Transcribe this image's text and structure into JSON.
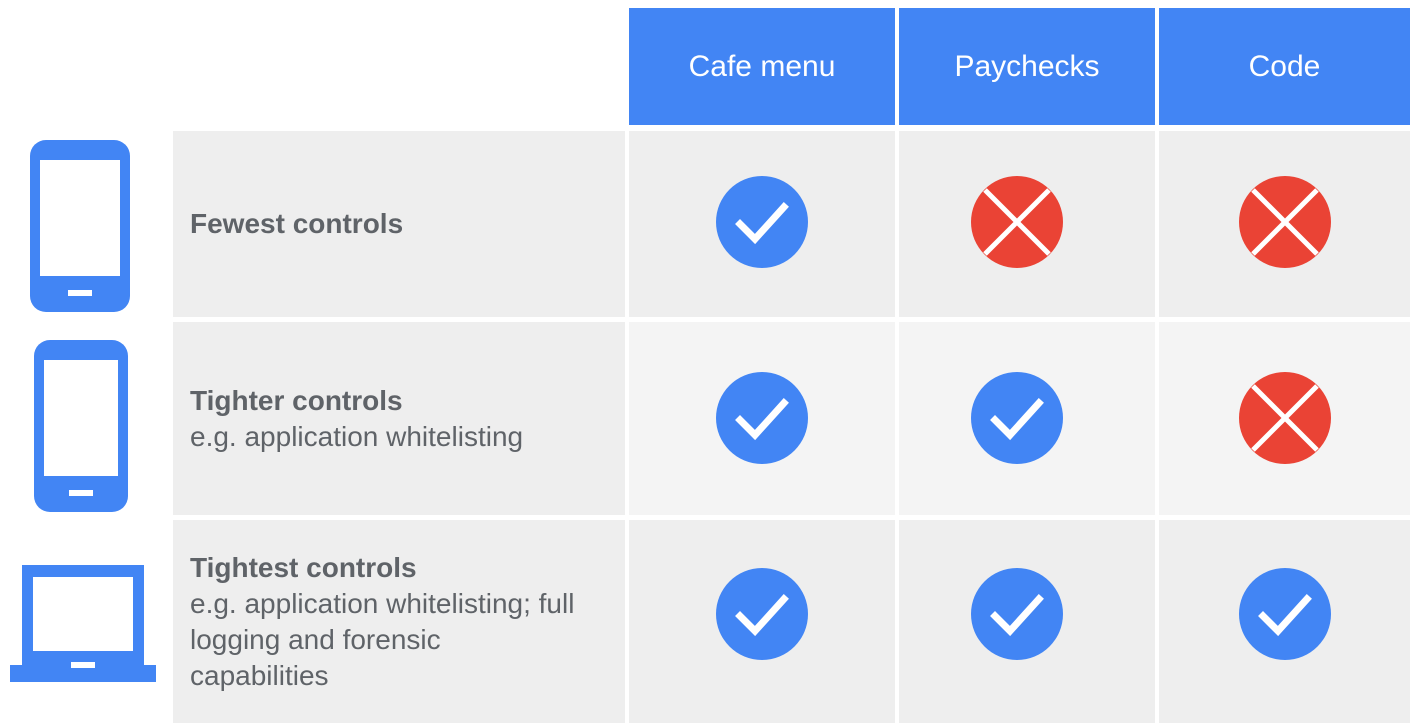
{
  "header": {
    "columns": [
      "Cafe menu",
      "Paychecks",
      "Code"
    ]
  },
  "rows": [
    {
      "device_icon": "phone-icon",
      "title": "Fewest controls",
      "description": "",
      "marks": [
        "check",
        "cross",
        "cross"
      ]
    },
    {
      "device_icon": "phone-icon",
      "title": "Tighter controls",
      "description": "e.g. application whitelisting",
      "marks": [
        "check",
        "check",
        "cross"
      ]
    },
    {
      "device_icon": "laptop-icon",
      "title": "Tightest controls",
      "description": "e.g. application whitelisting; full logging and forensic capabilities",
      "marks": [
        "check",
        "check",
        "check"
      ]
    }
  ],
  "colors": {
    "header_bg": "#4285f4",
    "check": "#4285f4",
    "cross": "#ea4335",
    "row_bg": "#eeeeee",
    "row_bg_alt": "#f4f4f4",
    "label_text": "#5f6368"
  }
}
